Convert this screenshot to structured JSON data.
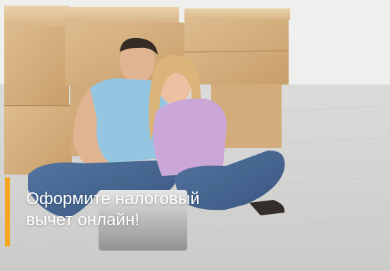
{
  "banner": {
    "headline_line1": "Оформите налоговый",
    "headline_line2": "вычет онлайн!",
    "accent_color": "#f5a623",
    "image_description_icon": "couple-with-laptop-photo"
  }
}
